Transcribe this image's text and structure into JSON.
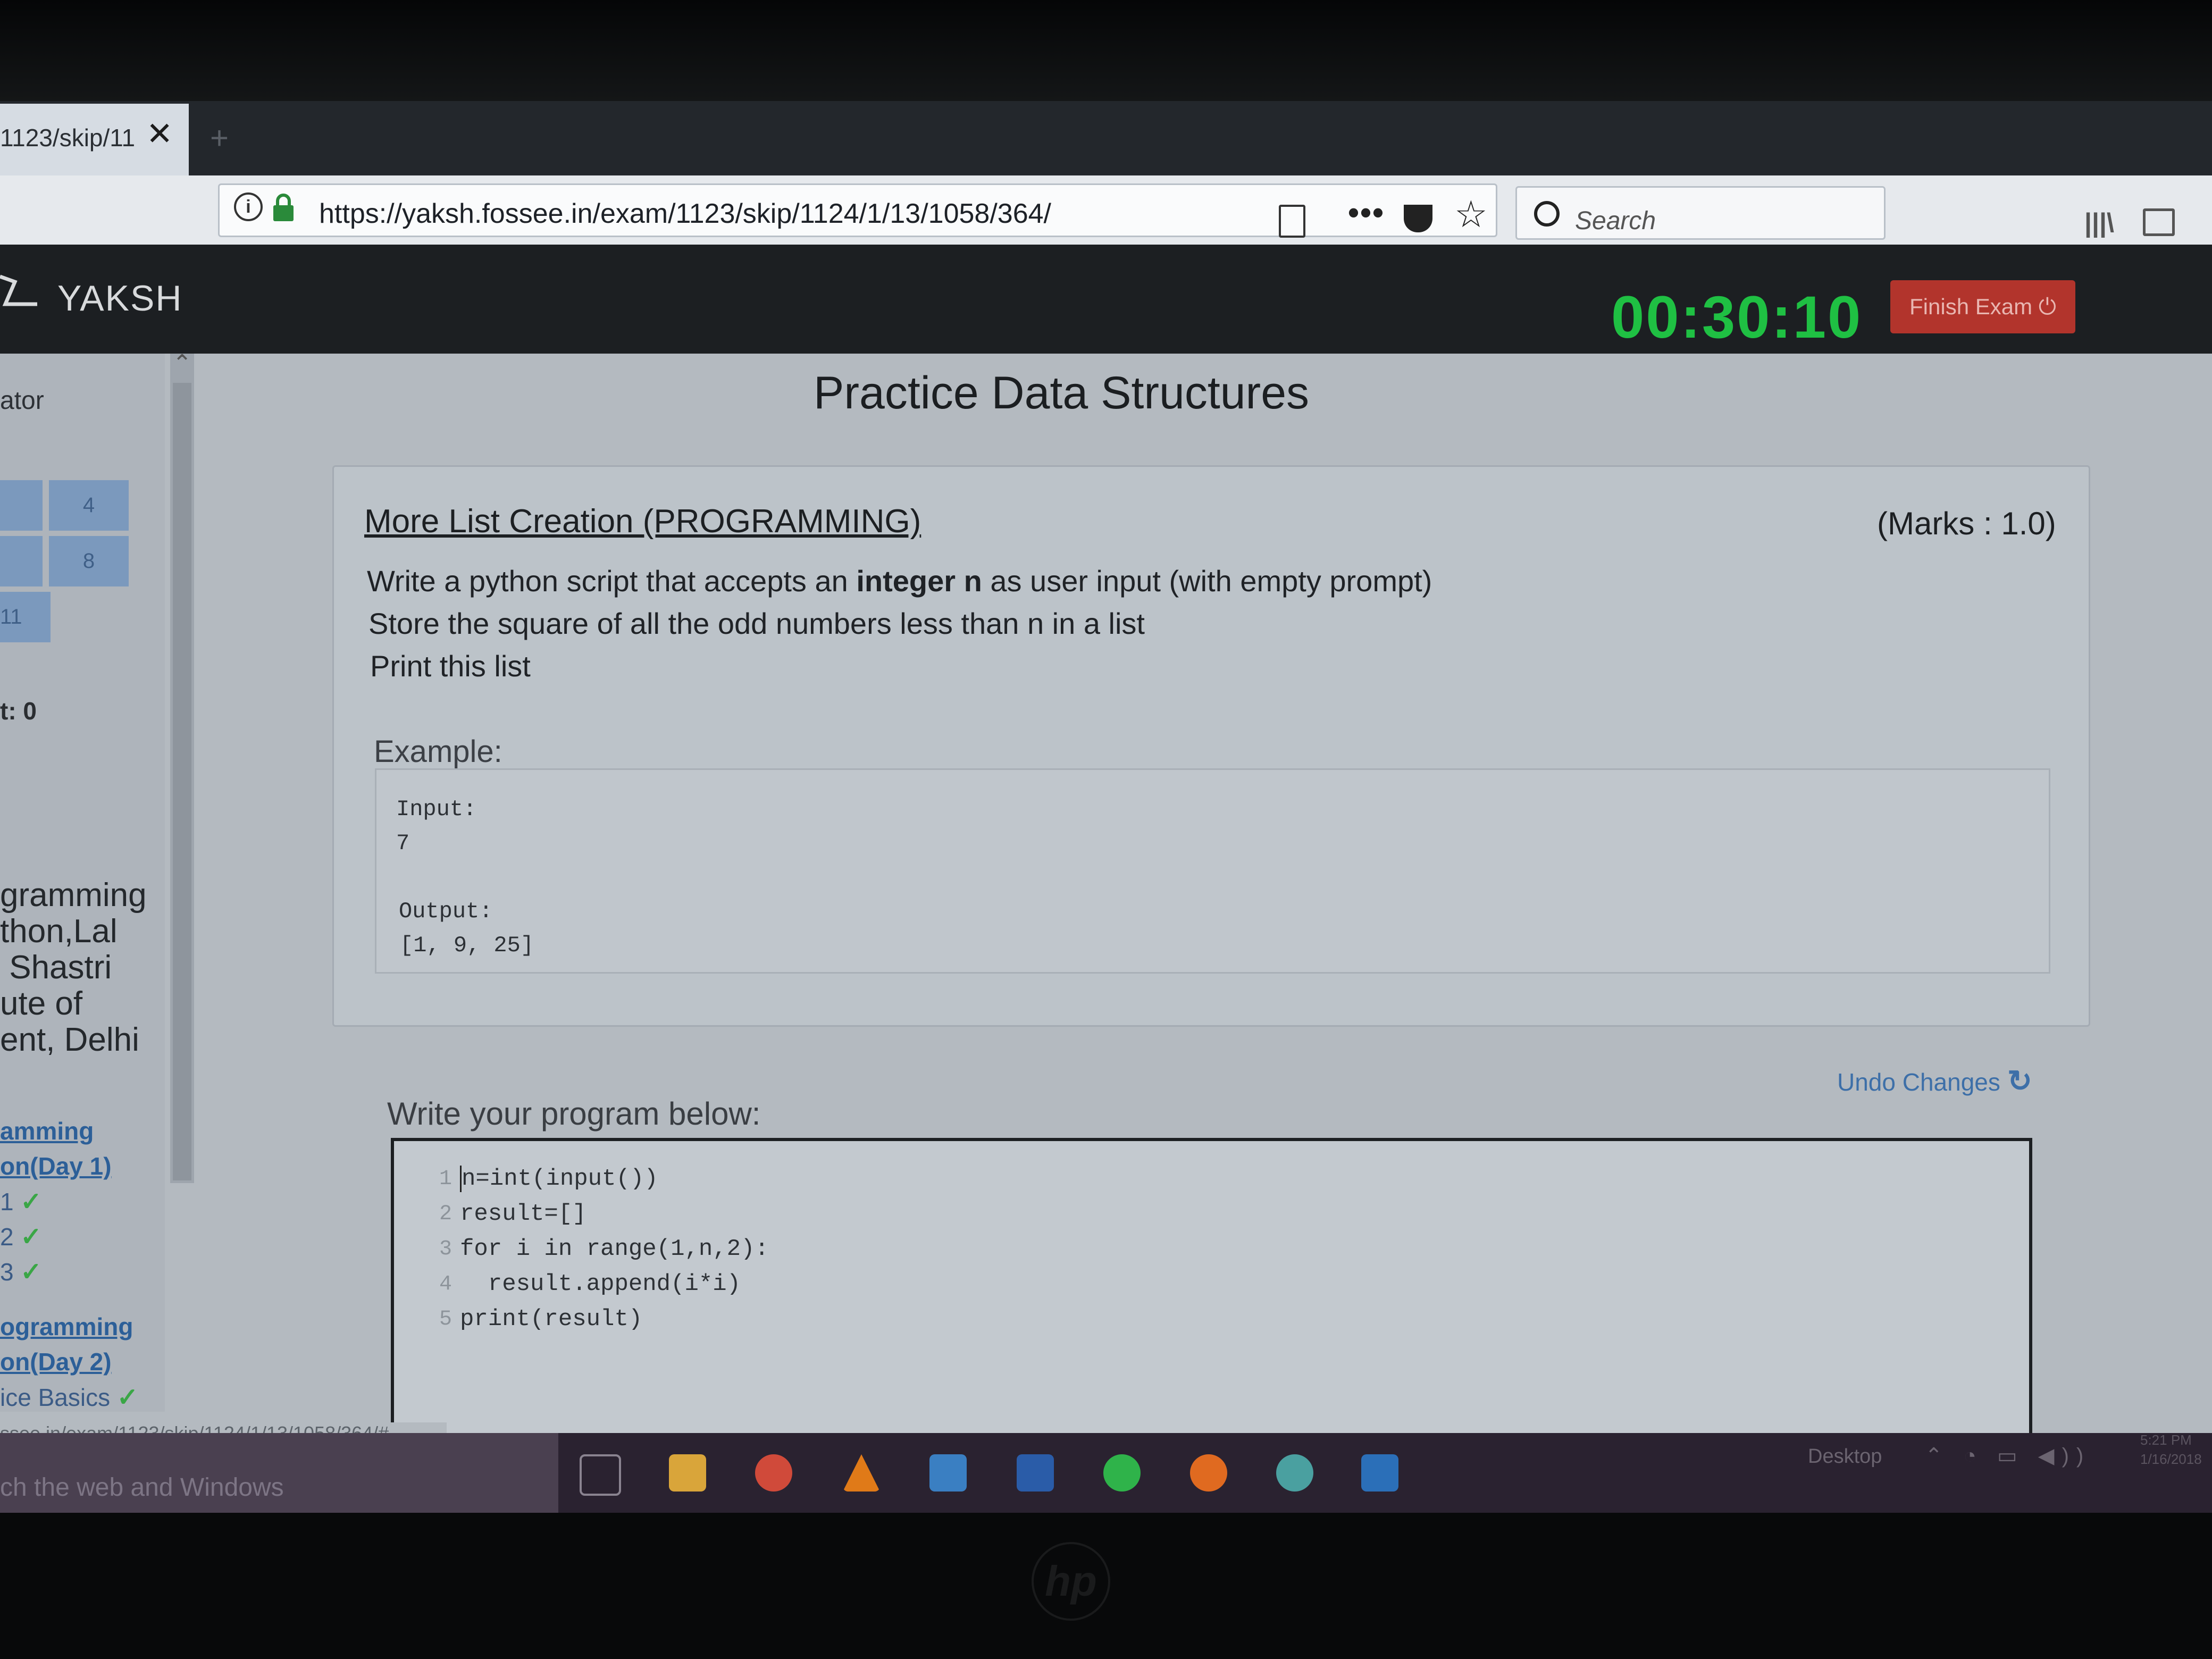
{
  "browser": {
    "tab_title": "1123/skip/11",
    "url": "https://yaksh.fossee.in/exam/1123/skip/1124/1/13/1058/364/",
    "search_placeholder": "Search"
  },
  "app": {
    "name": "YAKSH",
    "timer": "00:30:10",
    "finish_label": "Finish Exam"
  },
  "sidebar": {
    "title": "ator",
    "question_numbers": [
      "4",
      "8",
      "11"
    ],
    "attempt_label": "t: 0",
    "course_name": "gramming\nthon,Lal\n Shastri\nute of\nent, Delhi",
    "module1_link": [
      "amming",
      "on(Day 1)"
    ],
    "module1_items": [
      "1",
      "2",
      "3"
    ],
    "module2_link": [
      "ogramming",
      "on(Day 2)"
    ],
    "module2_item": "ice Basics"
  },
  "main": {
    "title": "Practice Data Structures",
    "question": {
      "title": "More List Creation (PROGRAMMING)",
      "marks": "(Marks : 1.0)",
      "line1_pre": "Write a python script that accepts an ",
      "line1_bold": "integer n",
      "line1_post": " as user input (with empty prompt)",
      "line2": "Store the square of all the odd numbers less than n in a list",
      "line3": "Print this list",
      "example_label": "Example:",
      "example_input_label": "Input:",
      "example_input": "7",
      "example_output_label": "Output:",
      "example_output": "[1, 9, 25]"
    },
    "undo_label": "Undo Changes",
    "editor_prompt": "Write your program below:",
    "code_lines": [
      "n=int(input())",
      "result=[]",
      "for i in range(1,n,2):",
      "  result.append(i*i)",
      "print(result)"
    ],
    "line_numbers": [
      "1",
      "2",
      "3",
      "4",
      "5"
    ]
  },
  "status_bar_url": "ssee.in/exam/1123/skip/1124/1/13/1058/364/#",
  "taskbar": {
    "search_text": "ch the web and Windows",
    "desktop_label": "Desktop",
    "clock_time": "5:21 PM",
    "clock_date": "1/16/2018"
  },
  "colors": {
    "timer": "#1fc043",
    "finish_button": "#b2342c",
    "link": "#2c5f98",
    "tick": "#3aa646"
  }
}
